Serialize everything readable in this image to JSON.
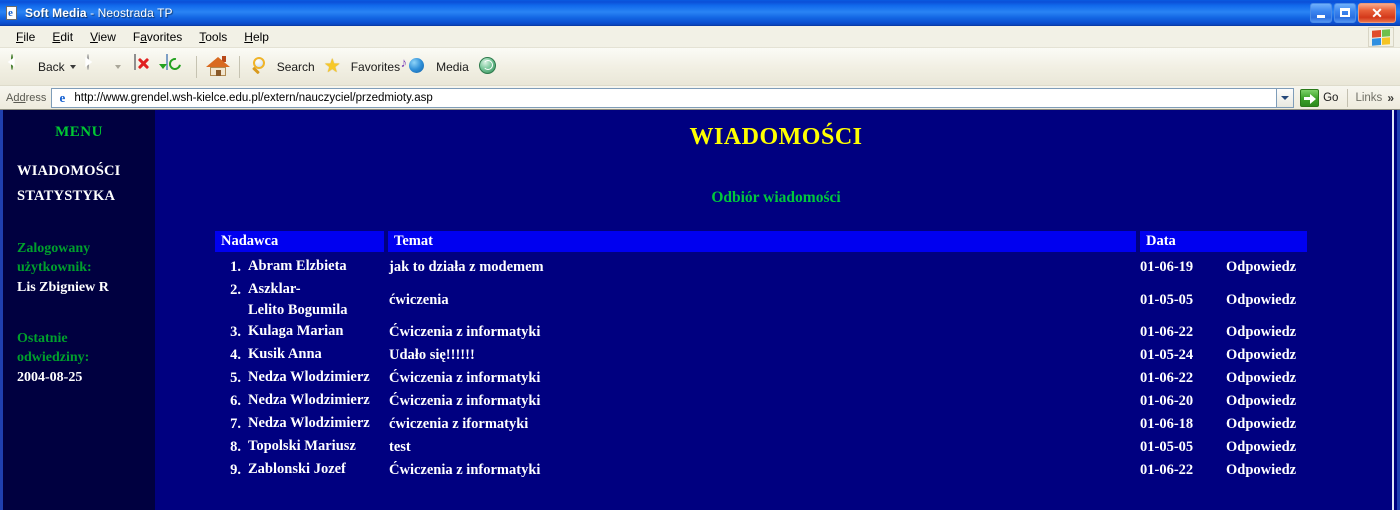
{
  "window": {
    "title_bold": "Soft Media",
    "title_rest": " - Neostrada TP",
    "icon": "ie-page-icon",
    "minimize_label": "Minimize",
    "maximize_label": "Maximize",
    "close_label": "Close"
  },
  "menubar": {
    "items": [
      {
        "label": "File",
        "accel": "F"
      },
      {
        "label": "Edit",
        "accel": "E"
      },
      {
        "label": "View",
        "accel": "V"
      },
      {
        "label": "Favorites",
        "accel": "a"
      },
      {
        "label": "Tools",
        "accel": "T"
      },
      {
        "label": "Help",
        "accel": "H"
      }
    ],
    "flag_icon": "windows-flag-icon"
  },
  "toolbar": {
    "back_label": "Back",
    "back_icon": "back-arrow-icon",
    "forward_icon": "forward-arrow-icon",
    "stop_icon": "stop-icon",
    "refresh_icon": "refresh-icon",
    "home_icon": "home-icon",
    "search_label": "Search",
    "search_icon": "search-icon",
    "favorites_label": "Favorites",
    "favorites_icon": "star-icon",
    "media_label": "Media",
    "media_icon": "media-globe-icon",
    "history_icon": "history-globe-icon"
  },
  "address": {
    "label": "Address",
    "label_accel": "dd",
    "url": "http://www.grendel.wsh-kielce.edu.pl/extern/nauczyciel/przedmioty.asp",
    "favicon": "ie-e-icon",
    "dropdown_icon": "chevron-down-icon",
    "go_label": "Go",
    "go_icon": "go-arrow-icon",
    "links_label": "Links",
    "links_chevron": "»"
  },
  "sidebar": {
    "menu_heading": "MENU",
    "links": [
      "WIADOMOŚCI",
      "STATYSTYKA"
    ],
    "user_caption_line1": "Zalogowany",
    "user_caption_line2": "użytkownik:",
    "user_name": "Lis Zbigniew R",
    "visit_caption_line1": "Ostatnie",
    "visit_caption_line2": "odwiedziny:",
    "visit_date": "2004-08-25"
  },
  "content": {
    "title": "WIADOMOŚCI",
    "subtitle": "Odbiór wiadomości",
    "table": {
      "headers": {
        "sender": "Nadawca",
        "subject": "Temat",
        "date": "Data"
      },
      "reply_label": "Odpowiedz",
      "rows": [
        {
          "num": "1.",
          "sender": "Abram Elzbieta",
          "sender_line2": "",
          "subject": "jak to działa z modemem",
          "date": "01-06-19",
          "reply": "Odpowiedz"
        },
        {
          "num": "2.",
          "sender": "Aszklar-",
          "sender_line2": "Lelito Bogumila",
          "subject": "ćwiczenia",
          "date": "01-05-05",
          "reply": "Odpowiedz"
        },
        {
          "num": "3.",
          "sender": "Kulaga Marian",
          "sender_line2": "",
          "subject": "Ćwiczenia z informatyki",
          "date": "01-06-22",
          "reply": "Odpowiedz"
        },
        {
          "num": "4.",
          "sender": "Kusik Anna",
          "sender_line2": "",
          "subject": "Udało się!!!!!!",
          "date": "01-05-24",
          "reply": "Odpowiedz"
        },
        {
          "num": "5.",
          "sender": "Nedza Wlodzimierz",
          "sender_line2": "",
          "subject": "Ćwiczenia z informatyki",
          "date": "01-06-22",
          "reply": "Odpowiedz"
        },
        {
          "num": "6.",
          "sender": "Nedza Wlodzimierz",
          "sender_line2": "",
          "subject": "Ćwiczenia z informatyki",
          "date": "01-06-20",
          "reply": "Odpowiedz"
        },
        {
          "num": "7.",
          "sender": "Nedza Wlodzimierz",
          "sender_line2": "",
          "subject": "ćwiczenia z iformatyki",
          "date": "01-06-18",
          "reply": "Odpowiedz"
        },
        {
          "num": "8.",
          "sender": "Topolski Mariusz",
          "sender_line2": "",
          "subject": "test",
          "date": "01-05-05",
          "reply": "Odpowiedz"
        },
        {
          "num": "9.",
          "sender": "Zablonski Jozef",
          "sender_line2": "",
          "subject": "Ćwiczenia z informatyki",
          "date": "01-06-22",
          "reply": "Odpowiedz"
        }
      ]
    }
  },
  "colors": {
    "page_bg": "#000080",
    "sidebar_bg": "#000040",
    "header_cell_bg": "#0000f0",
    "title_yellow": "#ffff00",
    "accent_green": "#00c83c",
    "text_white": "#ffffff"
  }
}
